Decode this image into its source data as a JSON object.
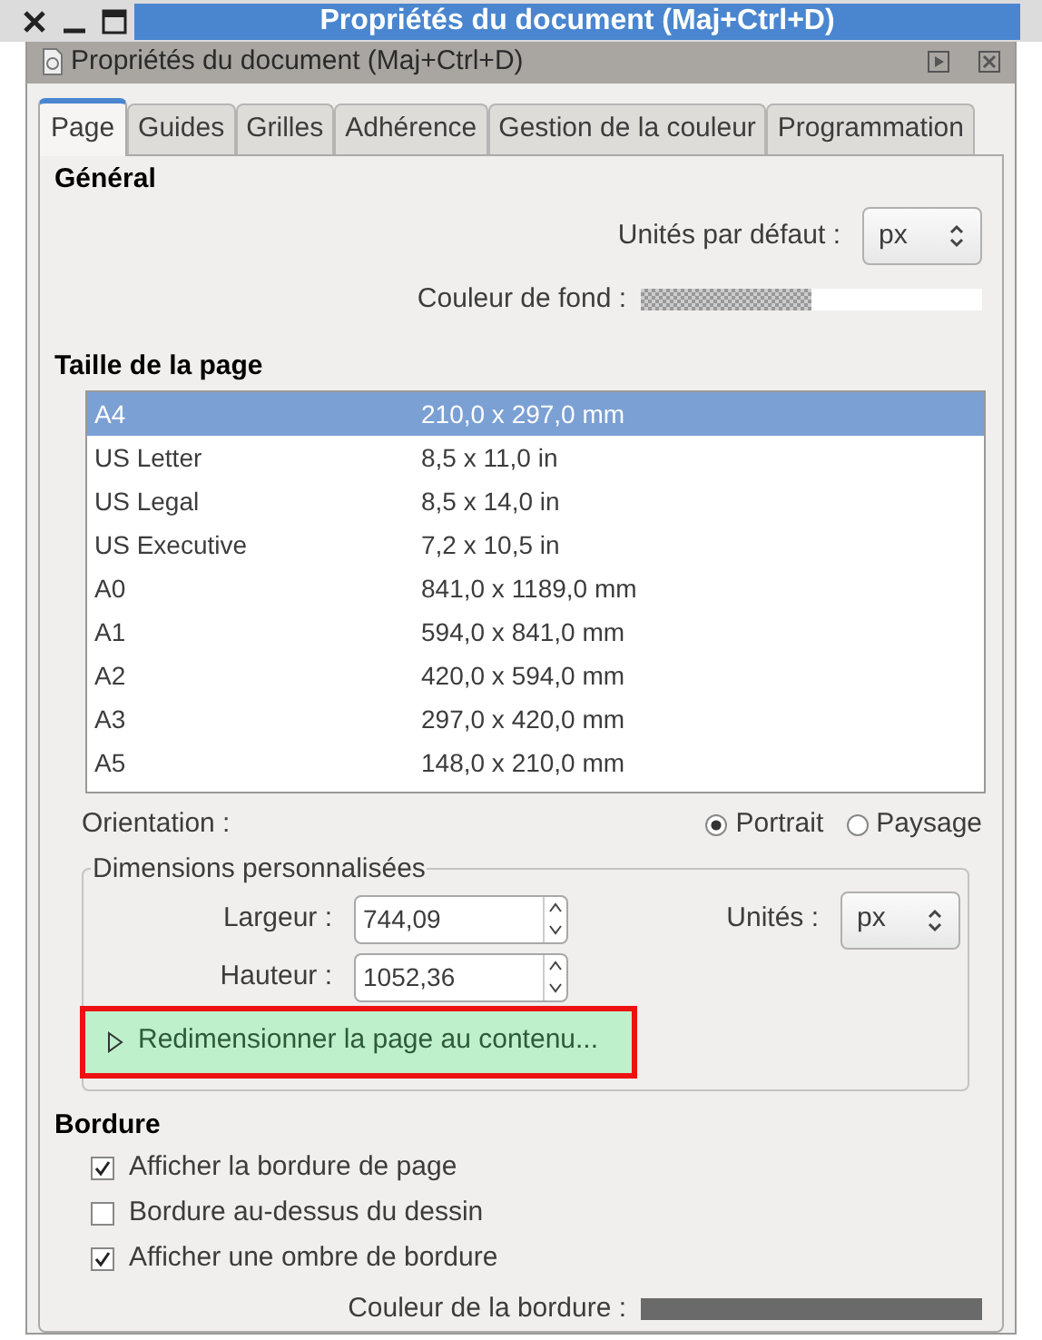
{
  "window": {
    "title": "Propriétés du document (Maj+Ctrl+D)"
  },
  "dock": {
    "title": "Propriétés du document (Maj+Ctrl+D)"
  },
  "tabs": [
    {
      "label": "Page",
      "selected": true
    },
    {
      "label": "Guides",
      "selected": false
    },
    {
      "label": "Grilles",
      "selected": false
    },
    {
      "label": "Adhérence",
      "selected": false
    },
    {
      "label": "Gestion de la couleur",
      "selected": false
    },
    {
      "label": "Programmation",
      "selected": false
    }
  ],
  "general": {
    "heading": "Général",
    "units_label": "Unités par défaut :",
    "units_value": "px",
    "background_label": "Couleur de fond :"
  },
  "page_size": {
    "heading": "Taille de la page",
    "rows": [
      {
        "name": "A4",
        "size": "210,0 x 297,0 mm",
        "selected": true
      },
      {
        "name": "US Letter",
        "size": "8,5 x 11,0 in",
        "selected": false
      },
      {
        "name": "US Legal",
        "size": "8,5 x 14,0 in",
        "selected": false
      },
      {
        "name": "US Executive",
        "size": "7,2 x 10,5 in",
        "selected": false
      },
      {
        "name": "A0",
        "size": "841,0 x 1189,0 mm",
        "selected": false
      },
      {
        "name": "A1",
        "size": "594,0 x 841,0 mm",
        "selected": false
      },
      {
        "name": "A2",
        "size": "420,0 x 594,0 mm",
        "selected": false
      },
      {
        "name": "A3",
        "size": "297,0 x 420,0 mm",
        "selected": false
      },
      {
        "name": "A5",
        "size": "148,0 x 210,0 mm",
        "selected": false
      }
    ]
  },
  "orientation": {
    "label": "Orientation :",
    "options": [
      {
        "label": "Portrait",
        "selected": true
      },
      {
        "label": "Paysage",
        "selected": false
      }
    ]
  },
  "custom": {
    "legend": "Dimensions personnalisées",
    "width_label": "Largeur :",
    "width_value": "744,09",
    "height_label": "Hauteur :",
    "height_value": "1052,36",
    "units_label": "Unités :",
    "units_value": "px",
    "resize_label": "Redimensionner la page au contenu...",
    "resize_expanded": false
  },
  "border": {
    "heading": "Bordure",
    "options": [
      {
        "label": "Afficher la bordure de page",
        "checked": true
      },
      {
        "label": "Bordure au-dessus du dessin",
        "checked": false
      },
      {
        "label": "Afficher une ombre de bordure",
        "checked": true
      }
    ],
    "color_label": "Couleur de la bordure :",
    "color": "#6a6a6a"
  }
}
